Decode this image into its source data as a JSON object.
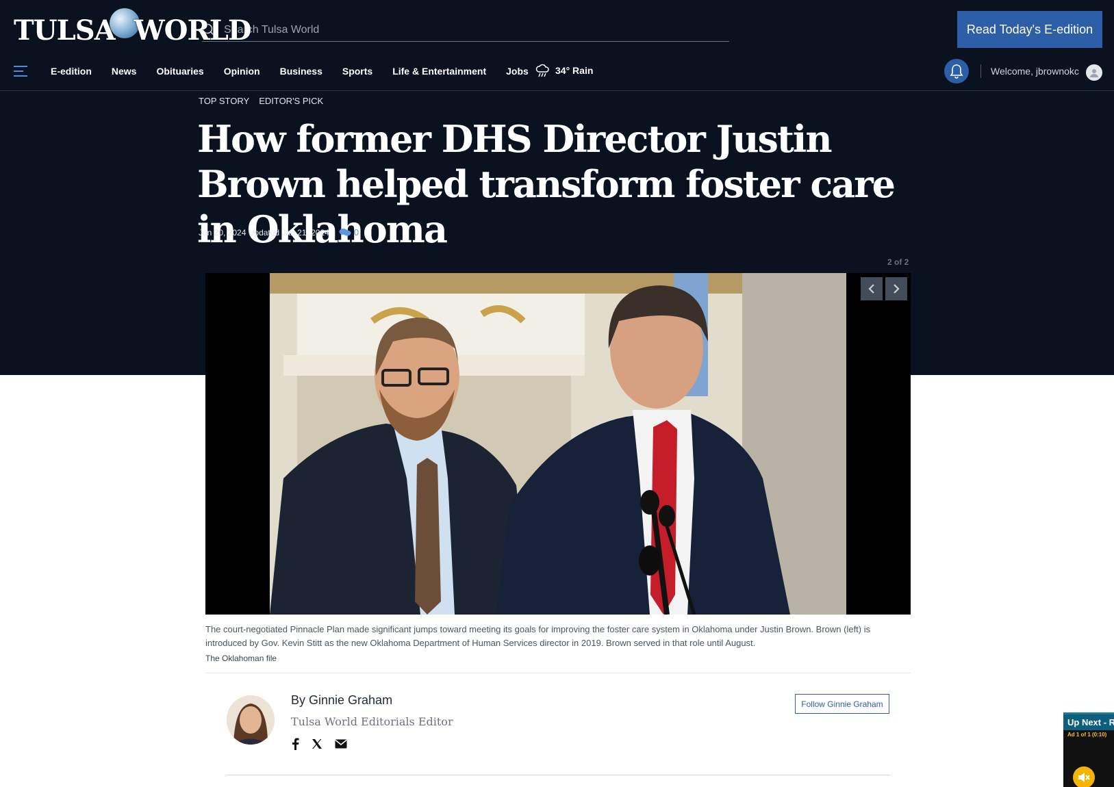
{
  "header": {
    "logo_text_left": "TULSA",
    "logo_text_right": "WORLD",
    "search_placeholder": "Search Tulsa World",
    "eedition_button": "Read Today's E-edition"
  },
  "nav": {
    "items": [
      "E-edition",
      "News",
      "Obituaries",
      "Opinion",
      "Business",
      "Sports",
      "Life & Entertainment",
      "Jobs"
    ],
    "weather": "34° Rain",
    "welcome": "Welcome, jbrownokc"
  },
  "article": {
    "tags": [
      "TOP STORY",
      "EDITOR'S PICK"
    ],
    "headline": "How former DHS Director Justin Brown helped transform foster care in Oklahoma",
    "dates": "Jan 20, 2024 Updated Jan 21, 2024",
    "comment_count": "0",
    "gallery_counter": "2 of 2",
    "caption": "The court-negotiated Pinnacle Plan made significant jumps toward meeting its goals for improving the foster care system in Oklahoma under Justin Brown. Brown (left) is introduced by Gov. Kevin Stitt as the new Oklahoma Department of Human Services director in 2019. Brown served in that role until August.",
    "credit": "The Oklahoman file"
  },
  "author": {
    "byline": "By Ginnie Graham",
    "title": "Tulsa World Editorials Editor",
    "follow_button": "Follow Ginnie Graham",
    "share_icons": [
      "facebook-icon",
      "x-icon",
      "email-icon"
    ]
  },
  "upnext": {
    "header": "Up Next - RE",
    "ad_label": "Ad 1 of 1 (0:10)"
  },
  "colors": {
    "dark_bg": "#0a1220",
    "accent_blue": "#2d5ea8",
    "link_blue": "#5b95e0"
  }
}
